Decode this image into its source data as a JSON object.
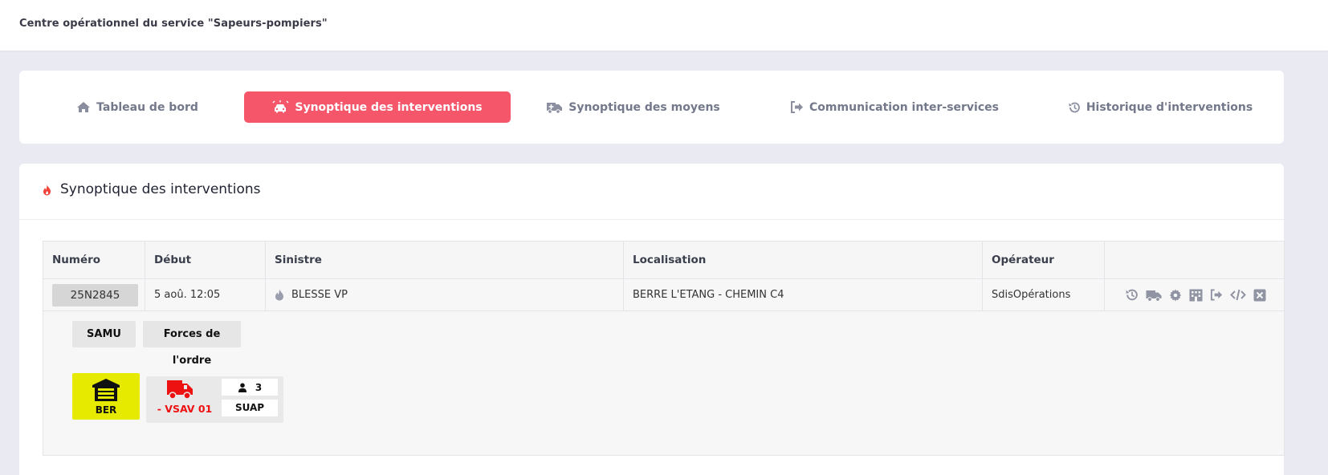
{
  "app": {
    "title": "Centre opérationnel du service \"Sapeurs-pompiers\""
  },
  "nav": {
    "tabs": [
      {
        "label": "Tableau de bord",
        "icon": "home-icon",
        "active": false
      },
      {
        "label": "Synoptique des interventions",
        "icon": "car-crash-icon",
        "active": true
      },
      {
        "label": "Synoptique des moyens",
        "icon": "ambulance-icon",
        "active": false
      },
      {
        "label": "Communication inter-services",
        "icon": "sign-out-icon",
        "active": false
      },
      {
        "label": "Historique d'interventions",
        "icon": "history-icon",
        "active": false
      }
    ]
  },
  "main": {
    "title": "Synoptique des interventions",
    "table": {
      "headers": [
        "Numéro",
        "Début",
        "Sinistre",
        "Localisation",
        "Opérateur",
        ""
      ],
      "rows": [
        {
          "numero": "25N2845",
          "debut": "5 aoû. 12:05",
          "sinistre": "BLESSE VP",
          "localisation": "BERRE L'ETANG - CHEMIN C4",
          "operateur": "SdisOpérations",
          "actions": [
            "history-icon",
            "truck-icon",
            "gear-icon",
            "building-icon",
            "sign-out-icon",
            "code-icon",
            "close-square-icon"
          ]
        }
      ]
    },
    "detail": {
      "services": [
        "SAMU",
        "Forces de l'ordre"
      ],
      "station": {
        "label": "BER",
        "icon": "garage-icon",
        "color": "#e5ea00"
      },
      "vehicle": {
        "name": "- VSAV 01",
        "crew_count": "3",
        "type": "SUAP",
        "color": "#ee1111"
      }
    }
  },
  "colors": {
    "accent": "#f5566a",
    "page_bg": "#eaeaf3",
    "nav_text": "#73788a"
  }
}
